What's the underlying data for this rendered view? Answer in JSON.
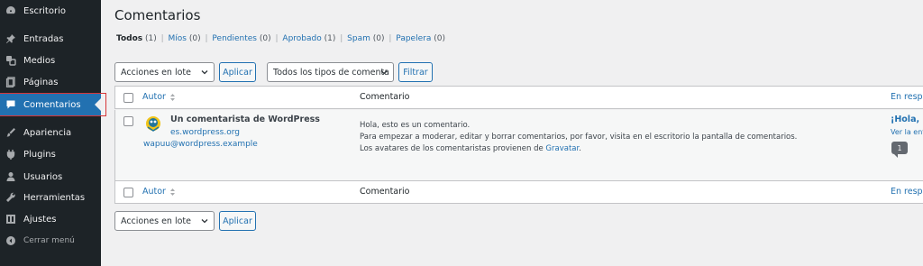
{
  "sidebar": {
    "items": [
      {
        "label": "Escritorio",
        "icon": "dashboard-icon"
      },
      {
        "label": "Entradas",
        "icon": "pin-icon"
      },
      {
        "label": "Medios",
        "icon": "media-icon"
      },
      {
        "label": "Páginas",
        "icon": "pages-icon"
      },
      {
        "label": "Comentarios",
        "icon": "comments-icon"
      },
      {
        "label": "Apariencia",
        "icon": "appearance-icon"
      },
      {
        "label": "Plugins",
        "icon": "plugins-icon"
      },
      {
        "label": "Usuarios",
        "icon": "users-icon"
      },
      {
        "label": "Herramientas",
        "icon": "tools-icon"
      },
      {
        "label": "Ajustes",
        "icon": "settings-icon"
      }
    ],
    "collapse_label": "Cerrar menú",
    "active_color": "#2271b1",
    "background": "#1d2327"
  },
  "page": {
    "title": "Comentarios"
  },
  "filters": {
    "links": [
      {
        "label": "Todos",
        "count": "(1)"
      },
      {
        "label": "Míos",
        "count": "(0)"
      },
      {
        "label": "Pendientes",
        "count": "(0)"
      },
      {
        "label": "Aprobado",
        "count": "(1)"
      },
      {
        "label": "Spam",
        "count": "(0)"
      },
      {
        "label": "Papelera",
        "count": "(0)"
      }
    ]
  },
  "bulk_top": {
    "select_value": "Acciones en lote",
    "apply_label": "Aplicar",
    "type_select_value": "Todos los tipos de comenta",
    "filter_label": "Filtrar"
  },
  "bulk_bottom": {
    "select_value": "Acciones en lote",
    "apply_label": "Aplicar"
  },
  "table": {
    "headers": {
      "author": "Autor",
      "comment": "Comentario",
      "response": "En respu"
    },
    "rows": [
      {
        "author_name": "Un comentarista de WordPress",
        "author_url": "es.wordpress.org",
        "author_email": "wapuu@wordpress.example",
        "comment_line1": "Hola, esto es un comentario.",
        "comment_line2": "Para empezar a moderar, editar y borrar comentarios, por favor, visita en el escritorio la pantalla de comentarios.",
        "comment_line3_prefix": "Los avatares de los comentaristas provienen de ",
        "comment_line3_link": "Gravatar",
        "comment_line3_suffix": ".",
        "post_title": "¡Hola, n",
        "post_view": "Ver la ent",
        "comment_count": "1"
      }
    ]
  }
}
